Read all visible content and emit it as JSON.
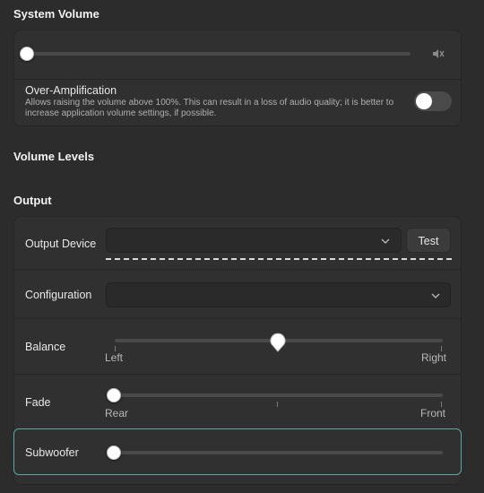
{
  "system_volume": {
    "title": "System Volume",
    "volume_level": 0,
    "mute_icon": "speaker-muted-icon"
  },
  "over_amplification": {
    "title": "Over-Amplification",
    "description": "Allows raising the volume above 100%. This can result in a loss of audio quality; it is better to increase application volume settings, if possible.",
    "enabled": false
  },
  "volume_levels": {
    "title": "Volume Levels"
  },
  "output": {
    "title": "Output",
    "device_label": "Output Device",
    "device_value": "",
    "test_label": "Test",
    "configuration_label": "Configuration",
    "configuration_value": "",
    "balance": {
      "label": "Balance",
      "left": "Left",
      "right": "Right",
      "value": 0.5
    },
    "fade": {
      "label": "Fade",
      "rear": "Rear",
      "front": "Front",
      "value": 0
    },
    "subwoofer": {
      "label": "Subwoofer",
      "value": 0
    }
  },
  "colors": {
    "background": "#2c2c2c",
    "card": "#303030",
    "focus_outline": "#5ea7a0"
  }
}
